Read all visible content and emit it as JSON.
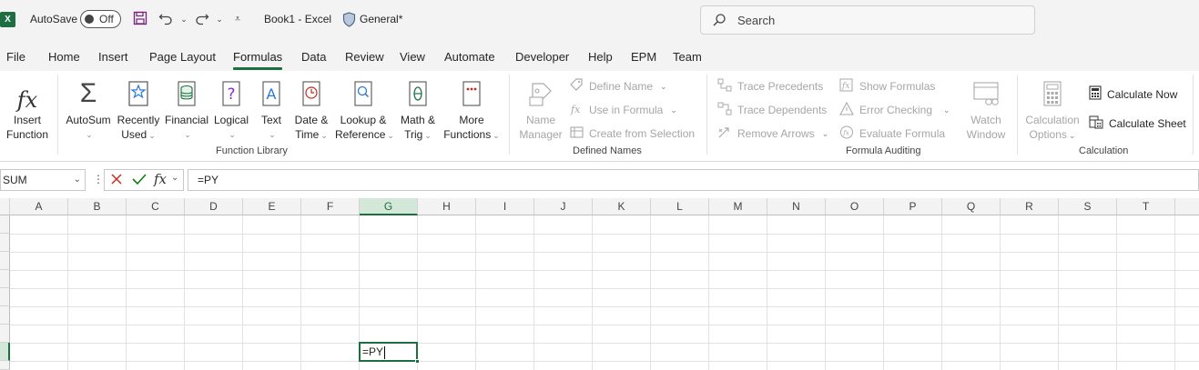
{
  "titlebar": {
    "autosave_label": "AutoSave",
    "autosave_state": "Off",
    "doc_title": "Book1  -  Excel",
    "sensitivity": "General*",
    "search_placeholder": "Search"
  },
  "tabs": [
    "File",
    "Home",
    "Insert",
    "Page Layout",
    "Formulas",
    "Data",
    "Review",
    "View",
    "Automate",
    "Developer",
    "Help",
    "EPM",
    "Team"
  ],
  "active_tab": "Formulas",
  "ribbon": {
    "function_library": {
      "label": "Function Library",
      "insert_function": [
        "Insert",
        "Function"
      ],
      "autosum": "AutoSum",
      "recently_used": [
        "Recently",
        "Used"
      ],
      "financial": "Financial",
      "logical": "Logical",
      "text": "Text",
      "date_time": [
        "Date &",
        "Time"
      ],
      "lookup_reference": [
        "Lookup &",
        "Reference"
      ],
      "math_trig": [
        "Math &",
        "Trig"
      ],
      "more_functions": [
        "More",
        "Functions"
      ]
    },
    "defined_names": {
      "label": "Defined Names",
      "name_manager": [
        "Name",
        "Manager"
      ],
      "define_name": "Define Name",
      "use_in_formula": "Use in Formula",
      "create_from_selection": "Create from Selection"
    },
    "formula_auditing": {
      "label": "Formula Auditing",
      "trace_precedents": "Trace Precedents",
      "trace_dependents": "Trace Dependents",
      "remove_arrows": "Remove Arrows",
      "show_formulas": "Show Formulas",
      "error_checking": "Error Checking",
      "evaluate_formula": "Evaluate Formula",
      "watch_window": [
        "Watch",
        "Window"
      ]
    },
    "calculation": {
      "label": "Calculation",
      "calculation_options": [
        "Calculation",
        "Options"
      ],
      "calculate_now": "Calculate Now",
      "calculate_sheet": "Calculate Sheet"
    }
  },
  "formula_bar": {
    "name_box": "SUM",
    "fx": "fx",
    "content": "=PY"
  },
  "grid": {
    "columns": [
      "A",
      "B",
      "C",
      "D",
      "E",
      "F",
      "G",
      "H",
      "I",
      "J",
      "K",
      "L",
      "M",
      "N",
      "O",
      "P",
      "Q",
      "R",
      "S",
      "T"
    ],
    "selected_column": "G",
    "active_cell_text": "=PY"
  },
  "colors": {
    "accent": "#1d6f42",
    "error_red": "#c42b1c",
    "check_green": "#107c10"
  }
}
